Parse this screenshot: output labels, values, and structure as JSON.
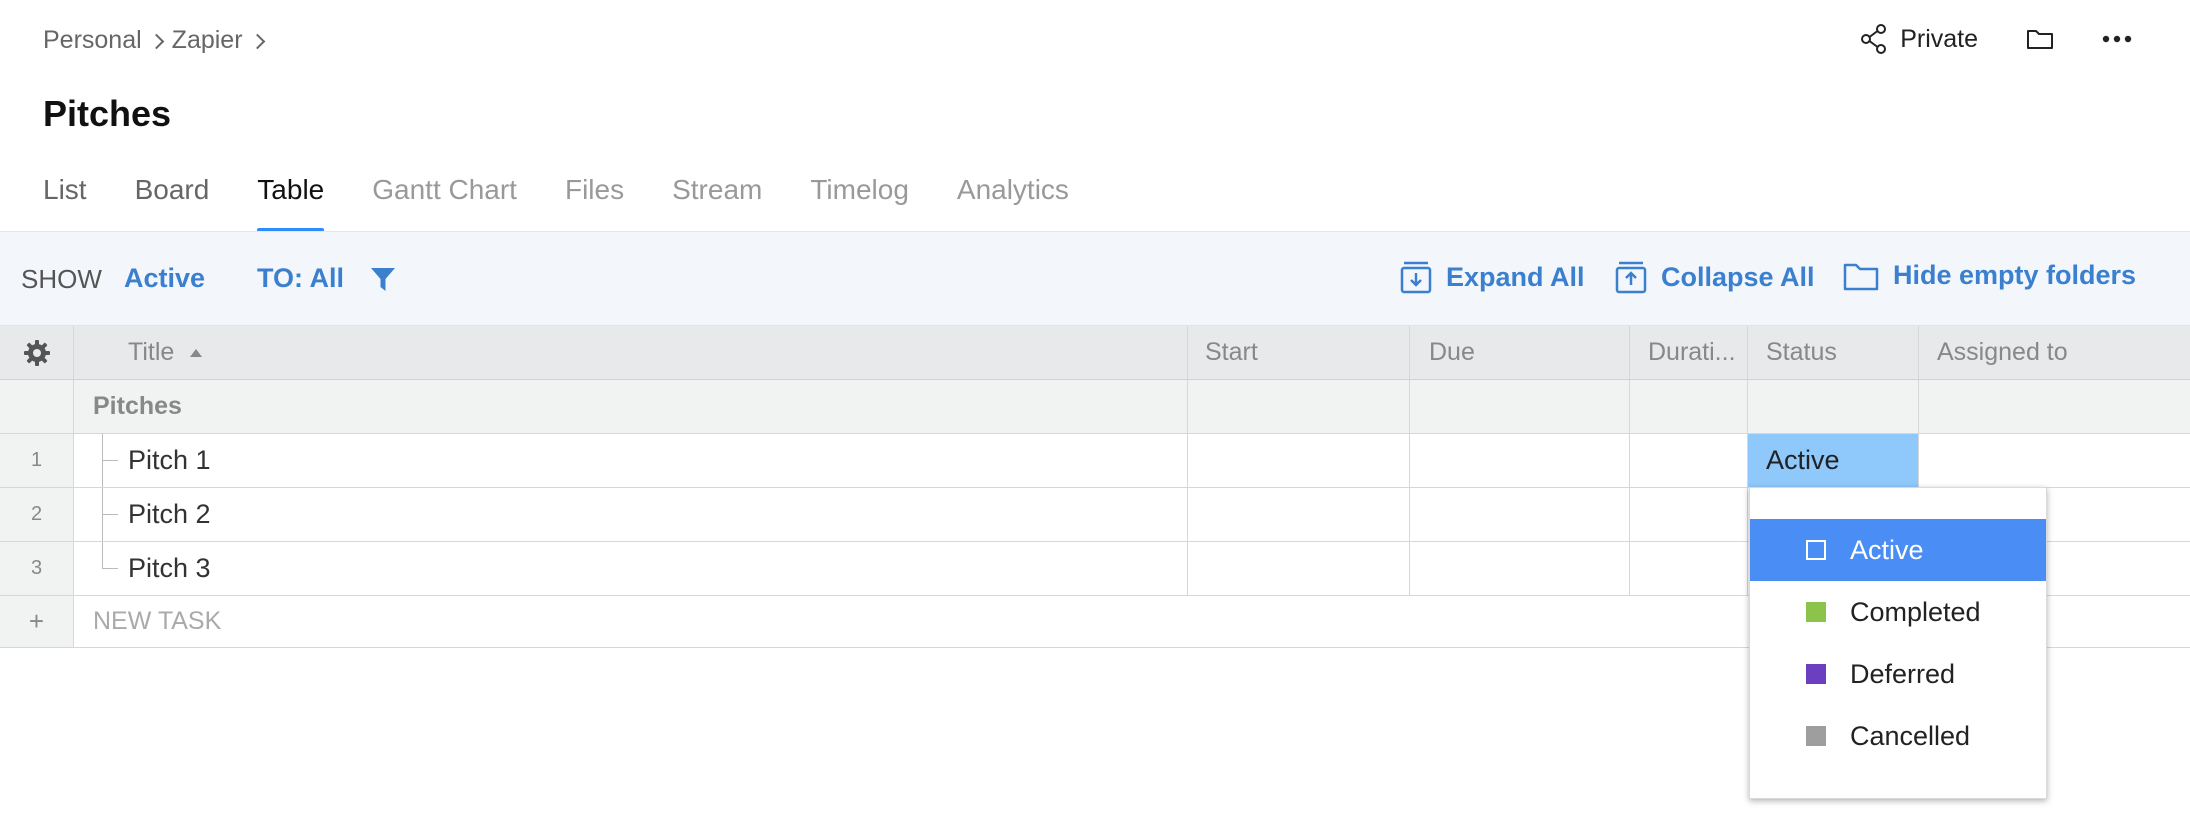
{
  "breadcrumb": [
    "Personal",
    "Zapier"
  ],
  "page_title": "Pitches",
  "header": {
    "privacy_label": "Private"
  },
  "tabs": [
    {
      "label": "List"
    },
    {
      "label": "Board"
    },
    {
      "label": "Table"
    },
    {
      "label": "Gantt Chart"
    },
    {
      "label": "Files"
    },
    {
      "label": "Stream"
    },
    {
      "label": "Timelog"
    },
    {
      "label": "Analytics"
    }
  ],
  "toolbar": {
    "show_label": "SHOW",
    "show_value": "Active",
    "to_value": "TO: All",
    "expand_all": "Expand All",
    "collapse_all": "Collapse All",
    "hide_empty": "Hide empty folders"
  },
  "table": {
    "columns": [
      "Title",
      "Start",
      "Due",
      "Durati...",
      "Status",
      "Assigned to"
    ],
    "group": "Pitches",
    "rows": [
      {
        "num": "1",
        "title": "Pitch 1",
        "status": "Active"
      },
      {
        "num": "2",
        "title": "Pitch 2",
        "status": ""
      },
      {
        "num": "3",
        "title": "Pitch 3",
        "status": ""
      }
    ],
    "new_task_label": "NEW TASK",
    "add_glyph": "+"
  },
  "status_dropdown": {
    "options": [
      {
        "label": "Active",
        "color": "#4a8ef5"
      },
      {
        "label": "Completed",
        "color": "#8cc34a"
      },
      {
        "label": "Deferred",
        "color": "#6b3fbf"
      },
      {
        "label": "Cancelled",
        "color": "#9e9e9e"
      }
    ]
  },
  "colors": {
    "accent": "#3b7fcf",
    "tab_underline": "#2f8cff",
    "selected": "#4a8ef5"
  }
}
